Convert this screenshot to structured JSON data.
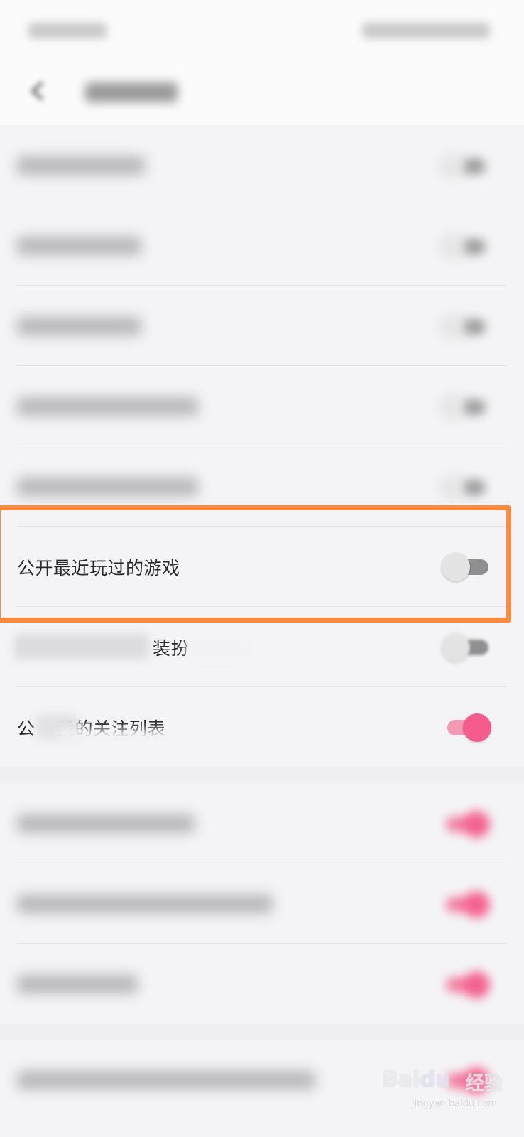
{
  "highlighted_row": {
    "label": "公开最近玩过的游戏",
    "toggle_on": false
  },
  "partial_rows": [
    {
      "visible_text": "装扮",
      "toggle_on": false
    },
    {
      "visible_text_a": "公",
      "visible_text_b": "我的关注列表",
      "toggle_on": true
    }
  ],
  "watermark": {
    "brand": "Bai",
    "brand2": "du",
    "cn": "经验",
    "url": "jingyan.baidu.com"
  },
  "colors": {
    "highlight": "#ff8a3d",
    "toggle_on": "#f35c8c",
    "toggle_off": "#8f8f8f"
  }
}
